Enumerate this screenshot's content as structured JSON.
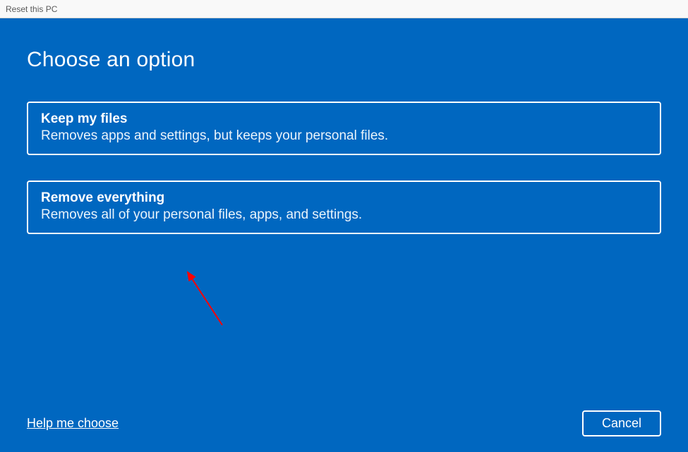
{
  "window": {
    "title": "Reset this PC"
  },
  "page": {
    "heading": "Choose an option"
  },
  "options": [
    {
      "title": "Keep my files",
      "desc": "Removes apps and settings, but keeps your personal files."
    },
    {
      "title": "Remove everything",
      "desc": "Removes all of your personal files, apps, and settings."
    }
  ],
  "help_link": "Help me choose",
  "cancel_label": "Cancel",
  "colors": {
    "accent": "#0067c0",
    "titlebar_bg": "#f9f9f9",
    "titlebar_text": "#5a5a5a",
    "arrow": "#ff0000"
  }
}
